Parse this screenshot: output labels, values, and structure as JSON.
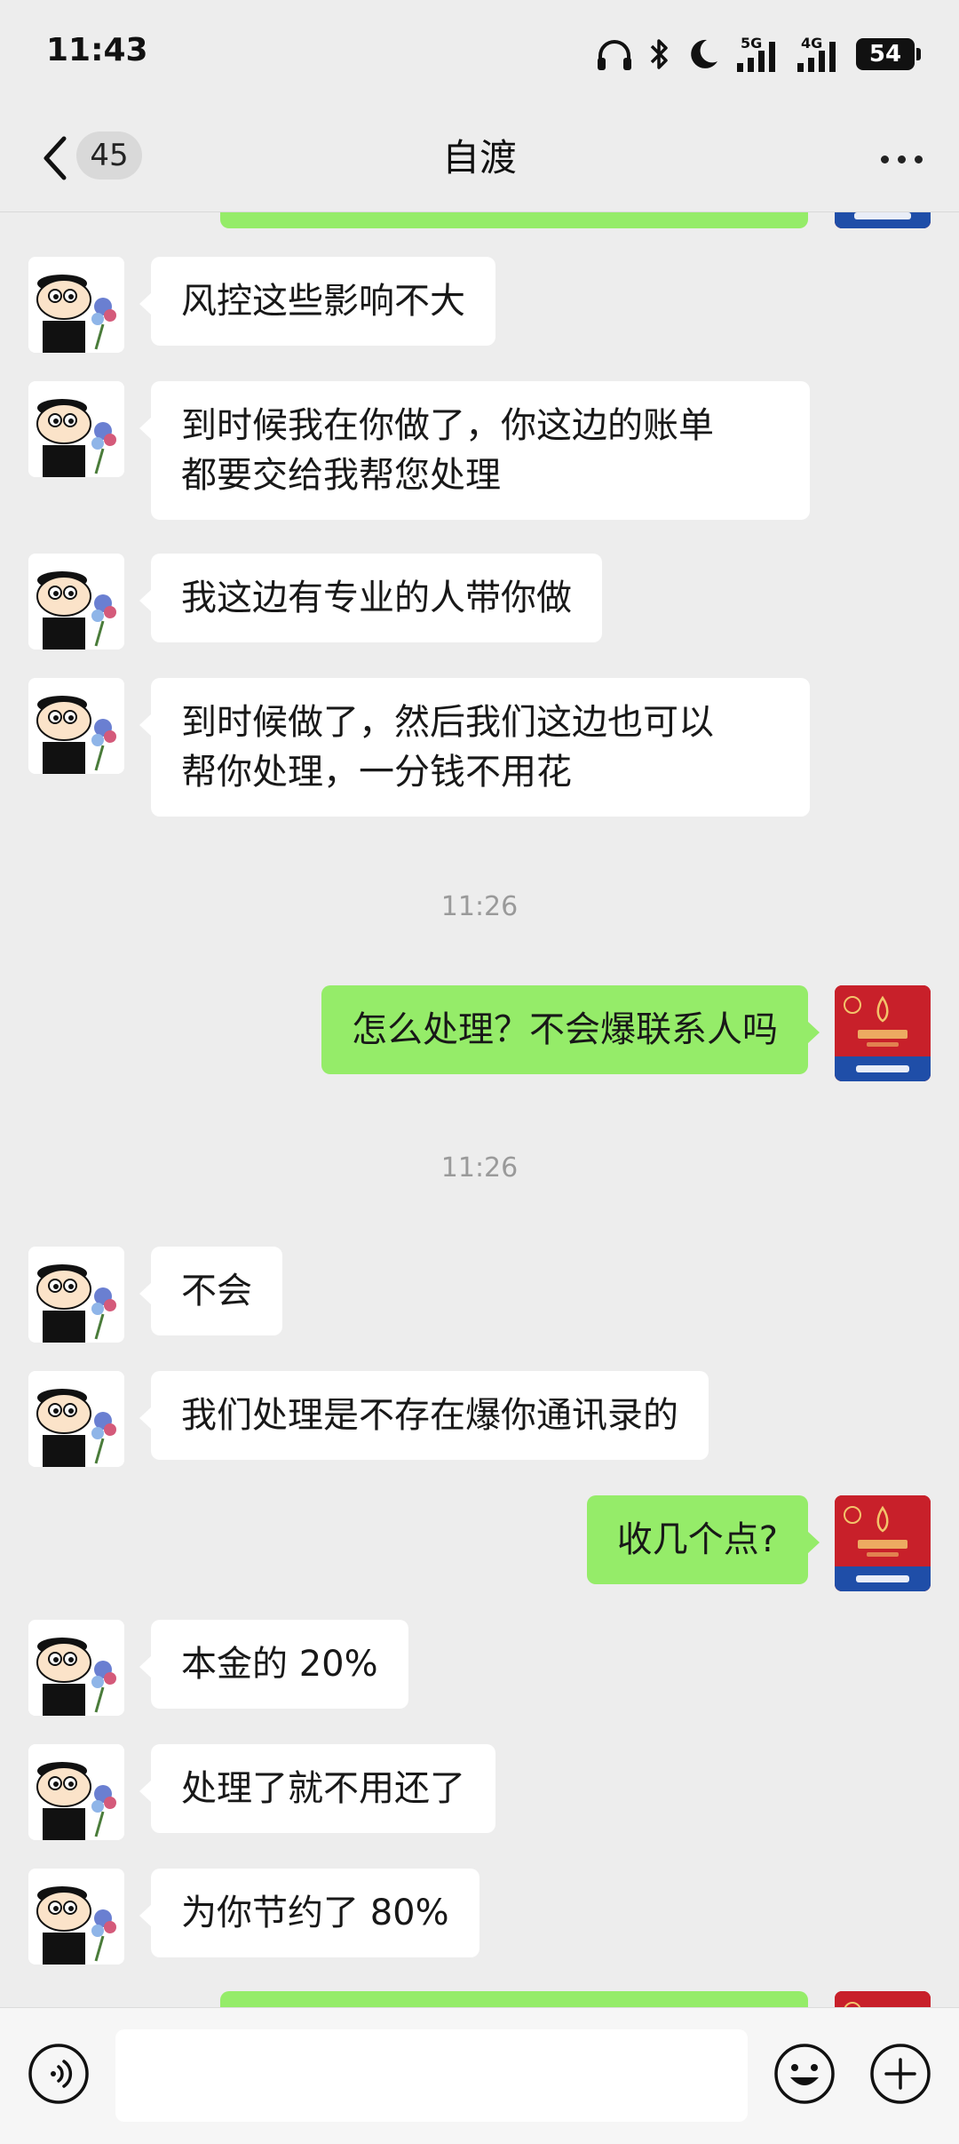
{
  "status_bar": {
    "time": "11:43",
    "signal_1_label": "5G",
    "signal_2_label": "4G",
    "battery": "54"
  },
  "header": {
    "back_badge": "45",
    "title": "自渡"
  },
  "messages": [
    {
      "from": "them",
      "text": "风控这些影响不大"
    },
    {
      "from": "them",
      "text": "到时候我在你做了，你这边的账单都要交给我帮您处理",
      "lines": [
        "到时候我在你做了，你这边的账单",
        "都要交给我帮您处理"
      ]
    },
    {
      "from": "them",
      "text": "我这边有专业的人带你做"
    },
    {
      "from": "them",
      "text": "到时候做了，然后我们这边也可以帮你处理，一分钱不用花",
      "lines": [
        "到时候做了，然后我们这边也可以",
        "帮你处理，一分钱不用花"
      ]
    },
    {
      "type": "time",
      "text": "11:26"
    },
    {
      "from": "me",
      "text": "怎么处理？不会爆联系人吗"
    },
    {
      "type": "time",
      "text": "11:26"
    },
    {
      "from": "them",
      "text": "不会"
    },
    {
      "from": "them",
      "text": "我们处理是不存在爆你通讯录的"
    },
    {
      "from": "me",
      "text": "收几个点?"
    },
    {
      "from": "them",
      "text": "本金的 20%"
    },
    {
      "from": "them",
      "text": "处理了就不用还了"
    },
    {
      "from": "them",
      "text": "为你节约了 80%"
    }
  ],
  "colors": {
    "background": "#ededed",
    "bubble_in": "#ffffff",
    "bubble_out": "#95ec69",
    "timestamp": "#9a9a9a"
  },
  "input_bar": {
    "value": "",
    "icons": [
      "voice-icon",
      "emoji-icon",
      "plus-icon"
    ]
  }
}
